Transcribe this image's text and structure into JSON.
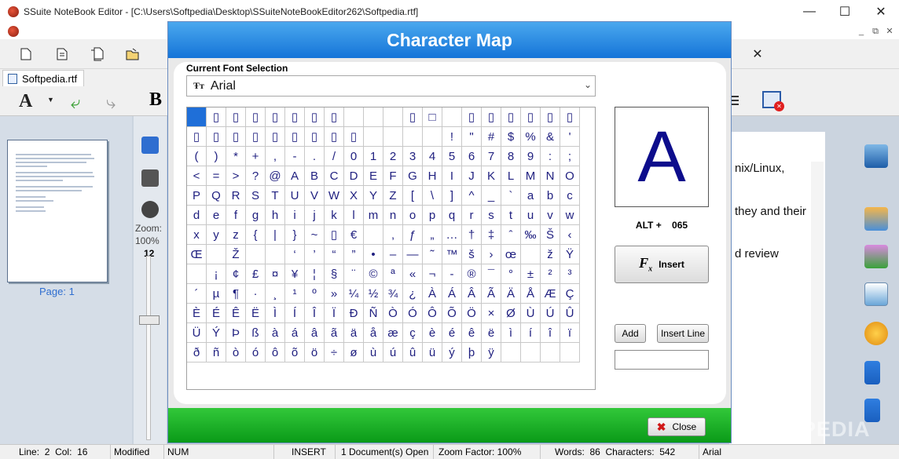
{
  "window": {
    "title": "SSuite NoteBook Editor - [C:\\Users\\Softpedia\\Desktop\\SSuiteNoteBookEditor262\\Softpedia.rtf]",
    "minimize_glyph": "—",
    "maximize_glyph": "☐",
    "close_glyph": "✕",
    "mdi_glyphs": [
      "_",
      "⧉",
      "✕"
    ]
  },
  "toolbar": {
    "close_doc_glyph": "✕"
  },
  "tab": {
    "label": "Softpedia.rtf"
  },
  "format_toolbar": {
    "font_glyph": "A",
    "bold_glyph": "B"
  },
  "left_panel": {
    "page_label": "Page: 1",
    "zoom_label": "Zoom:",
    "zoom_value": "100%",
    "slider_value": "12"
  },
  "document": {
    "lines": [
      "nix/Linux,",
      "they and their",
      "d review"
    ]
  },
  "dialog": {
    "title": "Character Map",
    "font_section_label": "Current Font Selection",
    "font_icon": "Ŧт",
    "font_value": "Arial",
    "font_arrow": "⌄",
    "preview_char": "A",
    "alt_label": "ALT +",
    "alt_code": "065",
    "insert_label": "Insert",
    "add_label": "Add",
    "insert_line_label": "Insert Line",
    "close_label": "Close",
    "grid": [
      [
        "",
        "▯",
        "▯",
        "▯",
        "▯",
        "▯",
        "▯",
        "▯",
        "",
        "",
        "",
        "▯",
        "□",
        "",
        "▯",
        "▯",
        "▯",
        "▯",
        "▯",
        "▯"
      ],
      [
        "▯",
        "▯",
        "▯",
        "▯",
        "▯",
        "▯",
        "▯",
        "▯",
        "▯",
        "",
        "",
        "",
        "",
        "!",
        "\"",
        "#",
        "$",
        "%",
        "&",
        "'"
      ],
      [
        "(",
        ")",
        "*",
        "+",
        ",",
        "-",
        ".",
        "/",
        "0",
        "1",
        "2",
        "3",
        "4",
        "5",
        "6",
        "7",
        "8",
        "9",
        ":",
        ";"
      ],
      [
        "<",
        "=",
        ">",
        "?",
        "@",
        "A",
        "B",
        "C",
        "D",
        "E",
        "F",
        "G",
        "H",
        "I",
        "J",
        "K",
        "L",
        "M",
        "N",
        "O"
      ],
      [
        "P",
        "Q",
        "R",
        "S",
        "T",
        "U",
        "V",
        "W",
        "X",
        "Y",
        "Z",
        "[",
        "\\",
        "]",
        "^",
        "_",
        "`",
        "a",
        "b",
        "c"
      ],
      [
        "d",
        "e",
        "f",
        "g",
        "h",
        "i",
        "j",
        "k",
        "l",
        "m",
        "n",
        "o",
        "p",
        "q",
        "r",
        "s",
        "t",
        "u",
        "v",
        "w"
      ],
      [
        "x",
        "y",
        "z",
        "{",
        "|",
        "}",
        "~",
        "▯",
        "€",
        "",
        "‚",
        "ƒ",
        "„",
        "…",
        "†",
        "‡",
        "ˆ",
        "‰",
        "Š",
        "‹"
      ],
      [
        "Œ",
        "",
        "Ž",
        "",
        "",
        "‘",
        "’",
        "“",
        "”",
        "•",
        "–",
        "—",
        "˜",
        "™",
        "š",
        "›",
        "œ",
        "",
        "ž",
        "Ÿ"
      ],
      [
        "",
        "¡",
        "¢",
        "£",
        "¤",
        "¥",
        "¦",
        "§",
        "¨",
        "©",
        "ª",
        "«",
        "¬",
        "-",
        "®",
        "¯",
        "°",
        "±",
        "²",
        "³"
      ],
      [
        "´",
        "µ",
        "¶",
        "·",
        "¸",
        "¹",
        "º",
        "»",
        "¼",
        "½",
        "¾",
        "¿",
        "À",
        "Á",
        "Â",
        "Ã",
        "Ä",
        "Å",
        "Æ",
        "Ç"
      ],
      [
        "È",
        "É",
        "Ê",
        "Ë",
        "Ì",
        "Í",
        "Î",
        "Ï",
        "Ð",
        "Ñ",
        "Ò",
        "Ó",
        "Ô",
        "Õ",
        "Ö",
        "×",
        "Ø",
        "Ù",
        "Ú",
        "Û"
      ],
      [
        "Ü",
        "Ý",
        "Þ",
        "ß",
        "à",
        "á",
        "â",
        "ã",
        "ä",
        "å",
        "æ",
        "ç",
        "è",
        "é",
        "ê",
        "ë",
        "ì",
        "í",
        "î",
        "ï"
      ],
      [
        "ð",
        "ñ",
        "ò",
        "ó",
        "ô",
        "õ",
        "ö",
        "÷",
        "ø",
        "ù",
        "ú",
        "û",
        "ü",
        "ý",
        "þ",
        "ÿ",
        "",
        "",
        "",
        ""
      ]
    ],
    "selected": {
      "row": 0,
      "col": 0
    }
  },
  "statusbar": {
    "line_label": "Line:",
    "line_value": "2",
    "col_label": "Col:",
    "col_value": "16",
    "modified": "Modified",
    "num": "NUM",
    "insert": "INSERT",
    "documents": "1 Document(s) Open",
    "zoom_factor": "Zoom Factor: 100%",
    "words_label": "Words:",
    "words_value": "86",
    "chars_label": "Characters:",
    "chars_value": "542",
    "font": "Arial"
  },
  "watermark": "SOFTPEDIA",
  "colors": {
    "dialog_header": "#1f8be6",
    "dialog_footer": "#16b024",
    "glyph_text": "#202080",
    "selected_cell": "#1f6fd8"
  }
}
